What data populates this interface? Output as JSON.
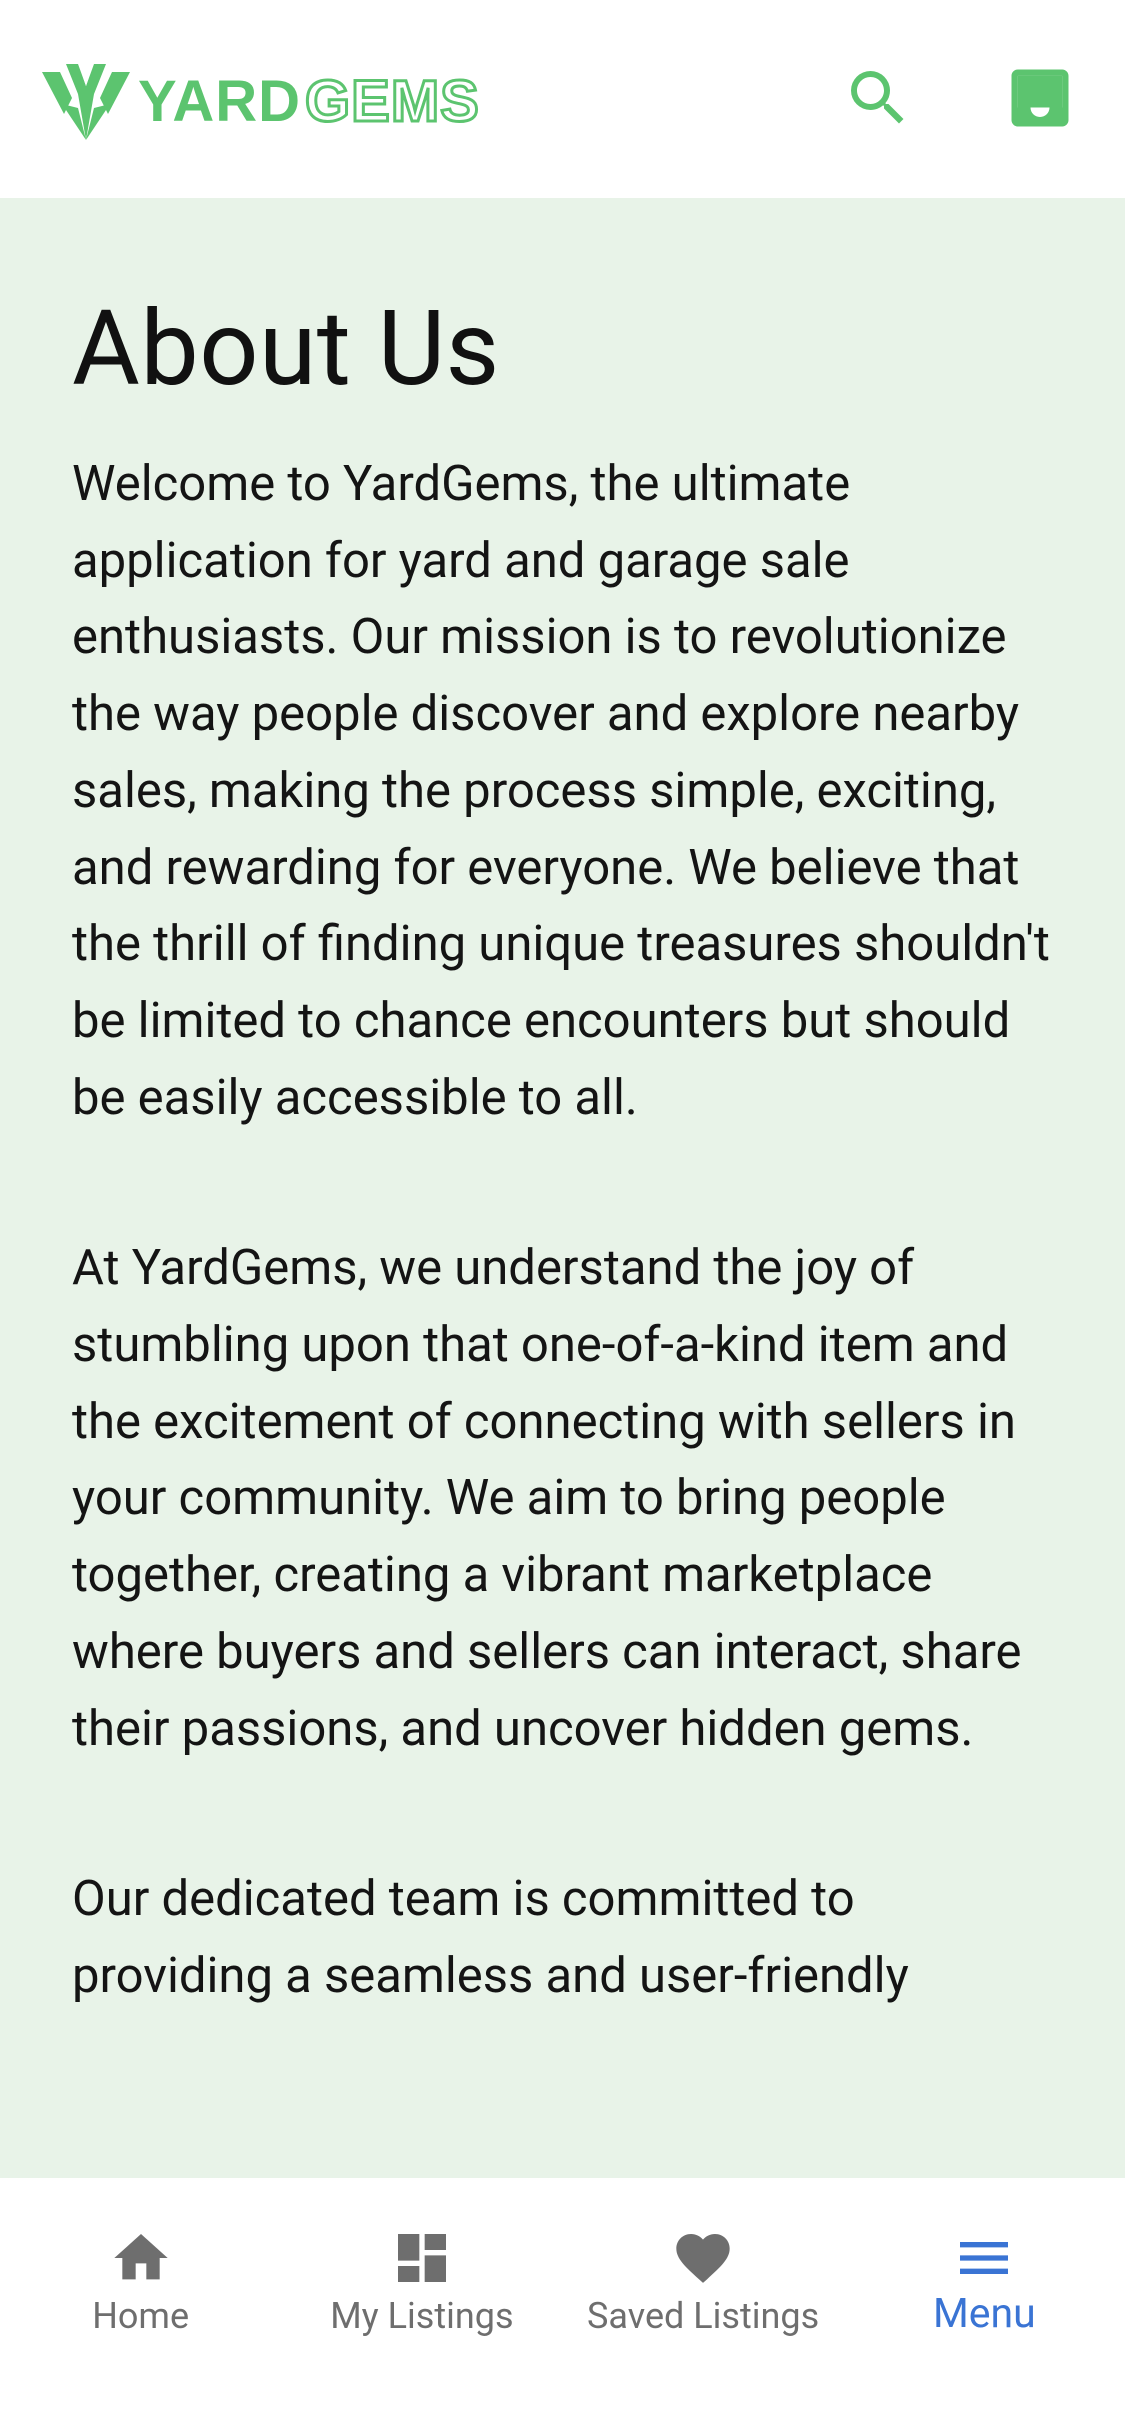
{
  "colors": {
    "brand_green": "#5cc46f",
    "content_background": "#e8f3e8",
    "nav_inactive": "#6e6e6e",
    "nav_active": "#3a74d4"
  },
  "header": {
    "logo": {
      "word1": "YARD",
      "word2": "GEMS",
      "icon": "yardgems-logo-mark"
    },
    "actions": [
      {
        "icon": "search-icon"
      },
      {
        "icon": "inbox-icon"
      }
    ]
  },
  "main": {
    "title": "About Us",
    "paragraphs": [
      "Welcome to YardGems, the ultimate application for yard and garage sale enthusiasts. Our mission is to revolutionize the way people discover and explore nearby sales, making the process simple, exciting, and rewarding for everyone. We believe that the thrill of finding unique treasures shouldn't be limited to chance encounters but should be easily accessible to all.",
      "At YardGems, we understand the joy of stumbling upon that one-of-a-kind item and the excitement of connecting with sellers in your community. We aim to bring people together, creating a vibrant marketplace where buyers and sellers can interact, share their passions, and uncover hidden gems.",
      "Our dedicated team is committed to providing a seamless and user-friendly"
    ]
  },
  "bottom_nav": {
    "items": [
      {
        "label": "Home",
        "icon": "home-icon",
        "active": false
      },
      {
        "label": "My Listings",
        "icon": "dashboard-icon",
        "active": false
      },
      {
        "label": "Saved Listings",
        "icon": "heart-icon",
        "active": false
      },
      {
        "label": "Menu",
        "icon": "menu-icon",
        "active": true
      }
    ]
  }
}
